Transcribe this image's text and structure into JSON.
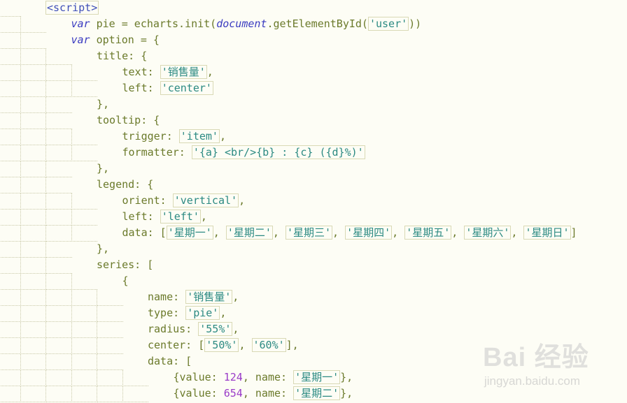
{
  "lines": [
    {
      "tokens": [
        [
          "tag",
          "<script>"
        ]
      ]
    },
    {
      "tokens": [
        [
          "kw",
          "var"
        ],
        [
          "p",
          " pie = echarts.init("
        ],
        [
          "kw",
          "document"
        ],
        [
          "p",
          ".getElementById("
        ],
        [
          "str",
          "'user'"
        ],
        [
          "p",
          "))"
        ]
      ]
    },
    {
      "tokens": [
        [
          "kw",
          "var"
        ],
        [
          "p",
          " option = {"
        ]
      ]
    },
    {
      "tokens": [
        [
          "p",
          "title: {"
        ]
      ]
    },
    {
      "tokens": [
        [
          "p",
          "text: "
        ],
        [
          "str",
          "'销售量'"
        ],
        [
          "p",
          ","
        ]
      ]
    },
    {
      "tokens": [
        [
          "p",
          "left: "
        ],
        [
          "str",
          "'center'"
        ]
      ]
    },
    {
      "tokens": [
        [
          "p",
          "},"
        ]
      ]
    },
    {
      "tokens": [
        [
          "p",
          "tooltip: {"
        ]
      ]
    },
    {
      "tokens": [
        [
          "p",
          "trigger: "
        ],
        [
          "str",
          "'item'"
        ],
        [
          "p",
          ","
        ]
      ]
    },
    {
      "tokens": [
        [
          "p",
          "formatter: "
        ],
        [
          "str",
          "'{a} <br/>{b} : {c} ({d}%)'"
        ]
      ]
    },
    {
      "tokens": [
        [
          "p",
          "},"
        ]
      ]
    },
    {
      "tokens": [
        [
          "p",
          "legend: {"
        ]
      ]
    },
    {
      "tokens": [
        [
          "p",
          "orient: "
        ],
        [
          "str",
          "'vertical'"
        ],
        [
          "p",
          ","
        ]
      ]
    },
    {
      "tokens": [
        [
          "p",
          "left: "
        ],
        [
          "str",
          "'left'"
        ],
        [
          "p",
          ","
        ]
      ]
    },
    {
      "tokens": [
        [
          "p",
          "data: ["
        ],
        [
          "str",
          "'星期一'"
        ],
        [
          "p",
          ", "
        ],
        [
          "str",
          "'星期二'"
        ],
        [
          "p",
          ", "
        ],
        [
          "str",
          "'星期三'"
        ],
        [
          "p",
          ", "
        ],
        [
          "str",
          "'星期四'"
        ],
        [
          "p",
          ", "
        ],
        [
          "str",
          "'星期五'"
        ],
        [
          "p",
          ", "
        ],
        [
          "str",
          "'星期六'"
        ],
        [
          "p",
          ", "
        ],
        [
          "str",
          "'星期日'"
        ],
        [
          "p",
          "]"
        ]
      ]
    },
    {
      "tokens": [
        [
          "p",
          "},"
        ]
      ]
    },
    {
      "tokens": [
        [
          "p",
          "series: ["
        ]
      ]
    },
    {
      "tokens": [
        [
          "p",
          "{"
        ]
      ]
    },
    {
      "tokens": [
        [
          "p",
          "name: "
        ],
        [
          "str",
          "'销售量'"
        ],
        [
          "p",
          ","
        ]
      ]
    },
    {
      "tokens": [
        [
          "p",
          "type: "
        ],
        [
          "str",
          "'pie'"
        ],
        [
          "p",
          ","
        ]
      ]
    },
    {
      "tokens": [
        [
          "p",
          "radius: "
        ],
        [
          "str",
          "'55%'"
        ],
        [
          "p",
          ","
        ]
      ]
    },
    {
      "tokens": [
        [
          "p",
          "center: ["
        ],
        [
          "str",
          "'50%'"
        ],
        [
          "p",
          ", "
        ],
        [
          "str",
          "'60%'"
        ],
        [
          "p",
          "],"
        ]
      ]
    },
    {
      "tokens": [
        [
          "p",
          "data: ["
        ]
      ]
    },
    {
      "tokens": [
        [
          "p",
          "{value: "
        ],
        [
          "num",
          "124"
        ],
        [
          "p",
          ", name: "
        ],
        [
          "str",
          "'星期一'"
        ],
        [
          "p",
          "},"
        ]
      ]
    },
    {
      "tokens": [
        [
          "p",
          "{value: "
        ],
        [
          "num",
          "654"
        ],
        [
          "p",
          ", name: "
        ],
        [
          "str",
          "'星期二'"
        ],
        [
          "p",
          "},"
        ]
      ]
    }
  ],
  "watermark": {
    "text": "Bai 经验",
    "url": "jingyan.baidu.com"
  }
}
